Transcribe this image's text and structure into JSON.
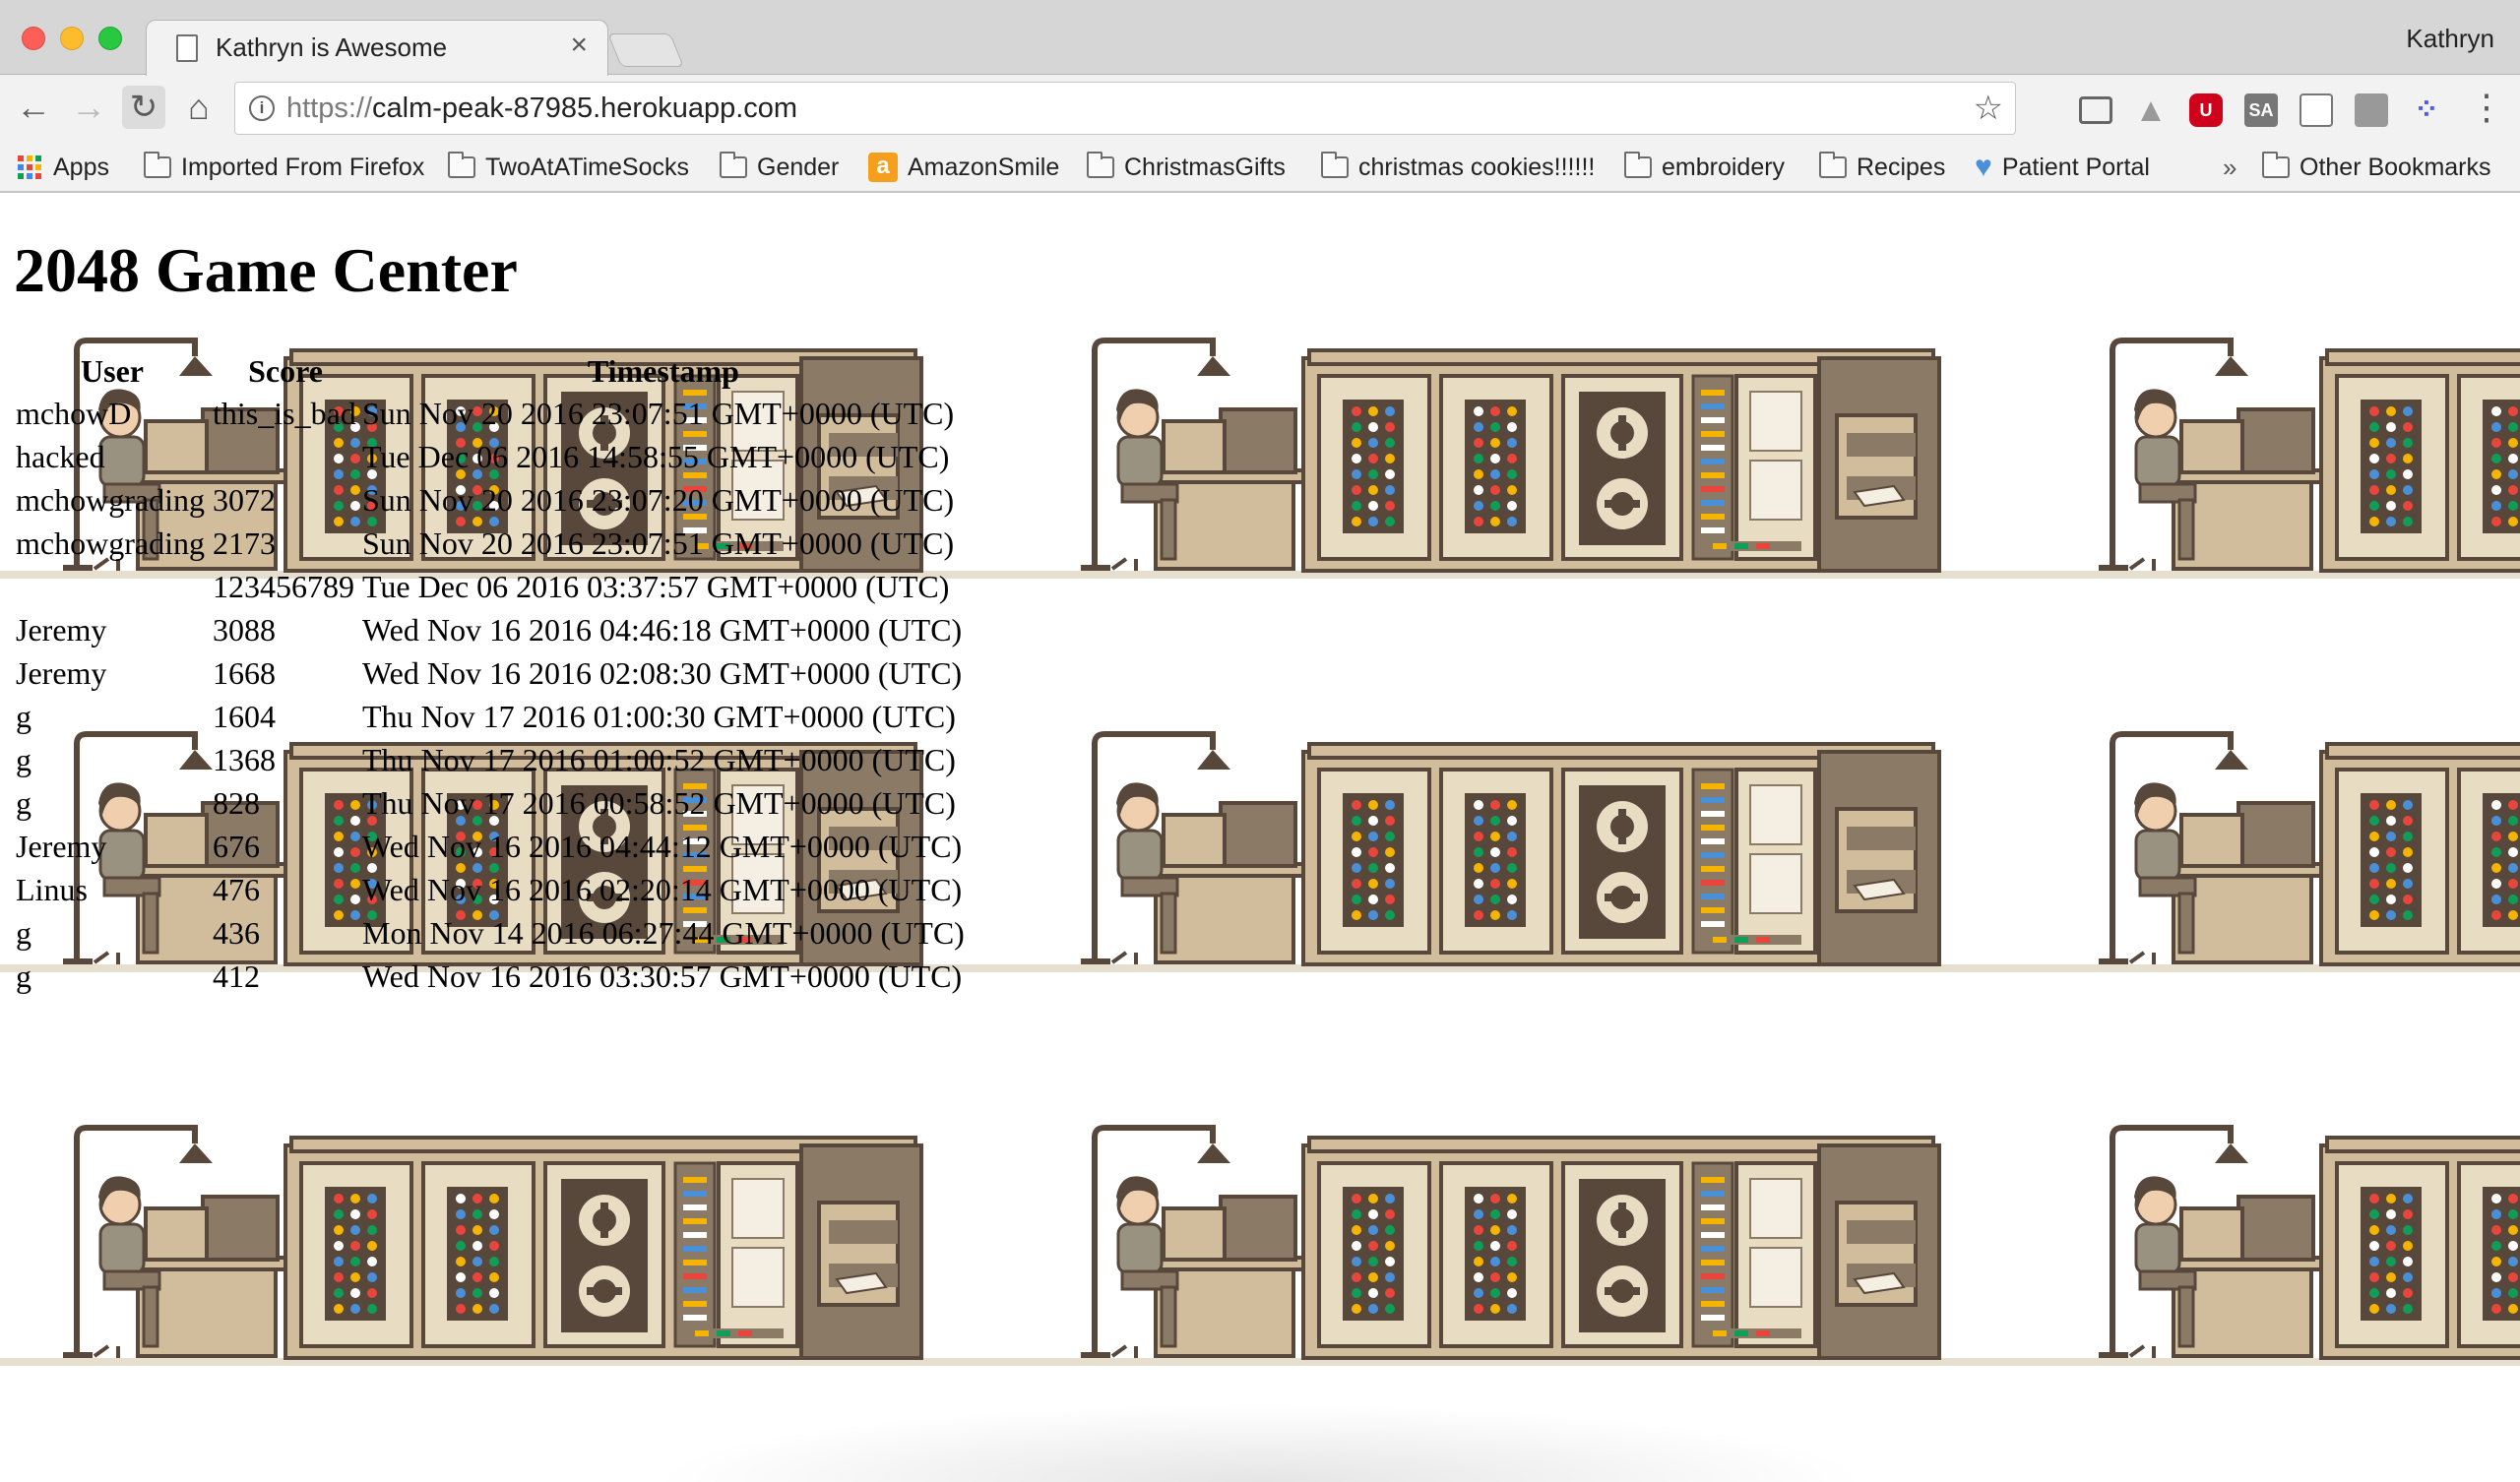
{
  "browser": {
    "tab_title": "Kathryn is Awesome",
    "tab_close": "×",
    "profile_name": "Kathryn",
    "url_scheme": "https://",
    "url_host": "calm-peak-87985.herokuapp.com",
    "nav": {
      "back": "←",
      "forward": "→",
      "reload": "↻",
      "home": "⌂"
    },
    "star": "☆",
    "extensions": {
      "ublock": "U",
      "sa": "SA",
      "dots": "⁘"
    },
    "menu": "⋮",
    "bookmarks": {
      "apps": "Apps",
      "imported": "Imported From Firefox",
      "socks": "TwoAtATimeSocks",
      "gender": "Gender",
      "amazon": "AmazonSmile",
      "amazon_icon": "a",
      "christmas_gifts": "ChristmasGifts",
      "cookies": "christmas cookies!!!!!!",
      "embroidery": "embroidery",
      "recipes": "Recipes",
      "patient_portal": "Patient Portal",
      "overflow": "»",
      "other": "Other Bookmarks"
    }
  },
  "page": {
    "title": "2048 Game Center",
    "table": {
      "headers": {
        "user": "User",
        "score": "Score",
        "timestamp": "Timestamp"
      },
      "rows": [
        {
          "user": "mchowD",
          "score": "this_is_bad",
          "timestamp": "Sun Nov 20 2016 23:07:51 GMT+0000 (UTC)"
        },
        {
          "user": "hacked",
          "score": "",
          "timestamp": "Tue Dec 06 2016 14:58:55 GMT+0000 (UTC)"
        },
        {
          "user": "mchowgrading",
          "score": "3072",
          "timestamp": "Sun Nov 20 2016 23:07:20 GMT+0000 (UTC)"
        },
        {
          "user": "mchowgrading",
          "score": "2173",
          "timestamp": "Sun Nov 20 2016 23:07:51 GMT+0000 (UTC)"
        },
        {
          "user": "",
          "score": "123456789",
          "timestamp": "Tue Dec 06 2016 03:37:57 GMT+0000 (UTC)"
        },
        {
          "user": "Jeremy",
          "score": "3088",
          "timestamp": "Wed Nov 16 2016 04:46:18 GMT+0000 (UTC)"
        },
        {
          "user": "Jeremy",
          "score": "1668",
          "timestamp": "Wed Nov 16 2016 02:08:30 GMT+0000 (UTC)"
        },
        {
          "user": "g",
          "score": "1604",
          "timestamp": "Thu Nov 17 2016 01:00:30 GMT+0000 (UTC)"
        },
        {
          "user": "g",
          "score": "1368",
          "timestamp": "Thu Nov 17 2016 01:00:52 GMT+0000 (UTC)"
        },
        {
          "user": "g",
          "score": "828",
          "timestamp": "Thu Nov 17 2016 00:58:52 GMT+0000 (UTC)"
        },
        {
          "user": "Jeremy",
          "score": "676",
          "timestamp": "Wed Nov 16 2016 04:44:12 GMT+0000 (UTC)"
        },
        {
          "user": "Linus",
          "score": "476",
          "timestamp": "Wed Nov 16 2016 02:20:14 GMT+0000 (UTC)"
        },
        {
          "user": "g",
          "score": "436",
          "timestamp": "Mon Nov 14 2016 06:27:44 GMT+0000 (UTC)"
        },
        {
          "user": "g",
          "score": "412",
          "timestamp": "Wed Nov 16 2016 03:30:57 GMT+0000 (UTC)"
        }
      ]
    }
  },
  "colors": {
    "tile_floor": "#e6dfd0",
    "cabinet": "#d1bd9c",
    "cabinet_dark": "#8a7a66",
    "outline": "#57483b",
    "skin": "#f0cfae",
    "clothes": "#9a9281"
  }
}
